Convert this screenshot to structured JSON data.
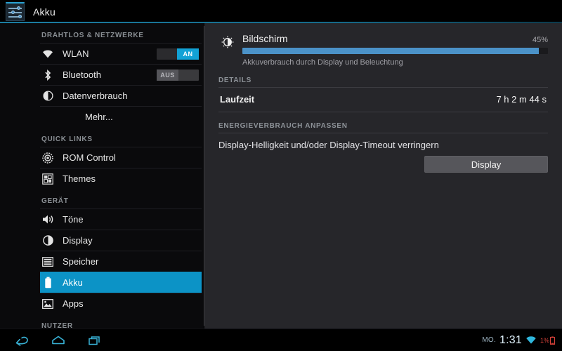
{
  "titlebar": {
    "app_title": "Akku",
    "app_icon": "settings-sliders-icon",
    "accent_color": "#2aa3d4"
  },
  "sidebar": {
    "sections": [
      {
        "header": "DRAHTLOS & NETZWERKE",
        "items": [
          {
            "label": "WLAN",
            "icon": "wifi-icon",
            "toggle": "AN",
            "toggle_state": "on"
          },
          {
            "label": "Bluetooth",
            "icon": "bluetooth-icon",
            "toggle": "AUS",
            "toggle_state": "off"
          },
          {
            "label": "Datenverbrauch",
            "icon": "data-usage-icon"
          },
          {
            "label": "Mehr...",
            "icon": "",
            "indent": true
          }
        ]
      },
      {
        "header": "QUICK LINKS",
        "items": [
          {
            "label": "ROM Control",
            "icon": "gear-icon"
          },
          {
            "label": "Themes",
            "icon": "themes-icon"
          }
        ]
      },
      {
        "header": "GERÄT",
        "items": [
          {
            "label": "Töne",
            "icon": "sound-icon"
          },
          {
            "label": "Display",
            "icon": "display-icon"
          },
          {
            "label": "Speicher",
            "icon": "storage-icon"
          },
          {
            "label": "Akku",
            "icon": "battery-icon",
            "selected": true
          },
          {
            "label": "Apps",
            "icon": "apps-icon"
          }
        ]
      },
      {
        "header": "NUTZER",
        "items": []
      }
    ],
    "selected_color": "#0c93c6"
  },
  "detail": {
    "usage": {
      "title": "Bildschirm",
      "icon": "brightness-icon",
      "percent_label": "45%",
      "percent_value": 45,
      "subtitle": "Akkuverbrauch durch Display und Beleuchtung",
      "bar_color": "#4b92c8"
    },
    "details_header": "DETAILS",
    "rows": [
      {
        "key": "Laufzeit",
        "value": "7 h 2 m 44 s"
      }
    ],
    "adjust_header": "ENERGIEVERBRAUCH ANPASSEN",
    "tip": "Display-Helligkeit und/oder Display-Timeout verringern",
    "action_button": "Display"
  },
  "navbar": {
    "back_icon": "back-arrow-icon",
    "home_icon": "home-icon",
    "recents_icon": "recent-apps-icon",
    "day": "MO.",
    "time": "1:31",
    "wifi_icon": "wifi-status-icon",
    "battery_icon": "battery-status-icon",
    "battery_level": "1%",
    "battery_color": "#d9433a",
    "icon_color": "#39b3d7"
  }
}
